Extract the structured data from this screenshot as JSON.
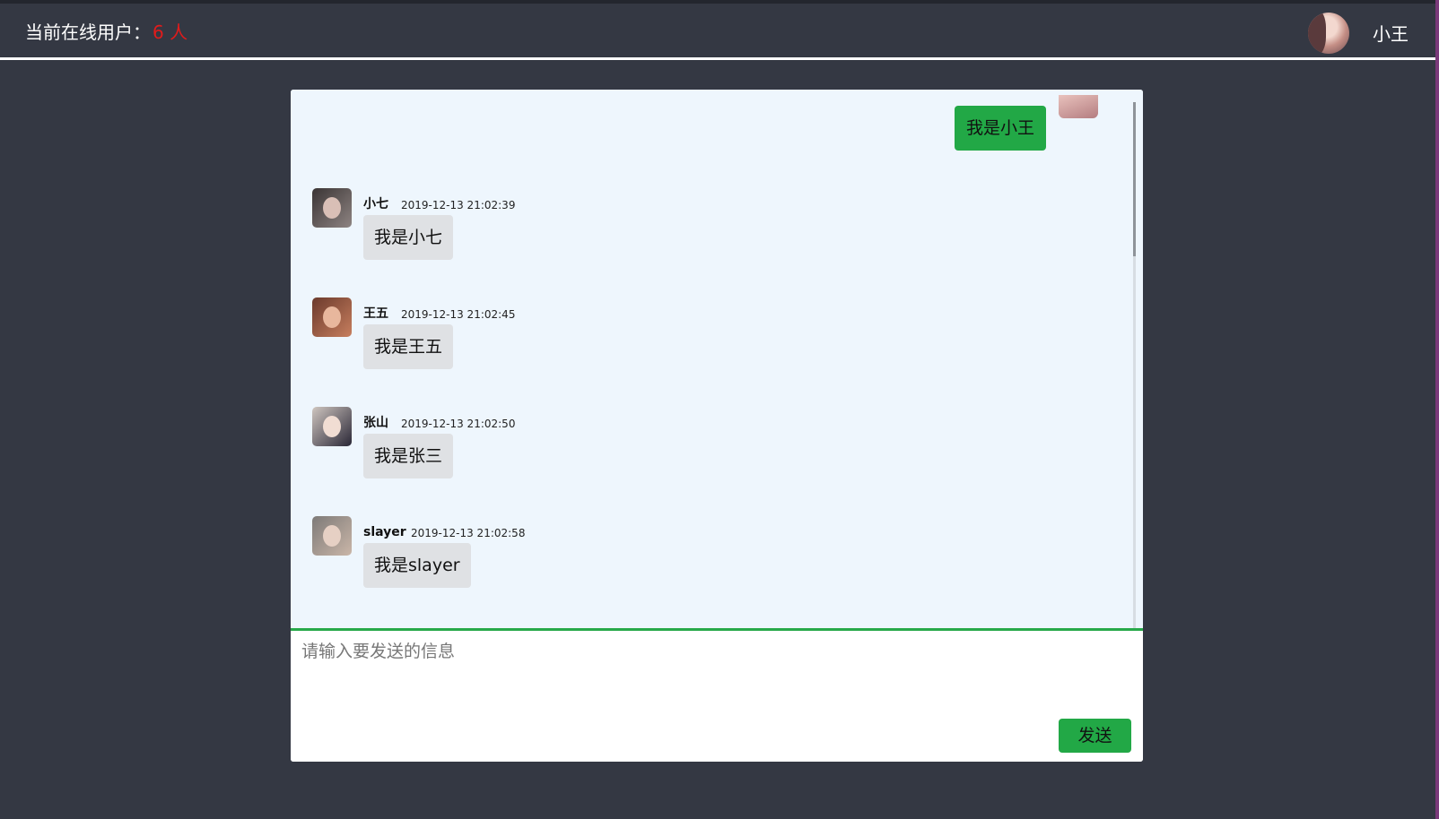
{
  "header": {
    "online_label": "当前在线用户：",
    "online_count": "6 人",
    "current_user": "小王"
  },
  "self_message": {
    "text": "我是小王"
  },
  "messages": [
    {
      "name": "小七",
      "time": "2019-12-13 21:02:39",
      "text": "我是小七"
    },
    {
      "name": "王五",
      "time": "2019-12-13 21:02:45",
      "text": "我是王五"
    },
    {
      "name": "张山",
      "time": "2019-12-13 21:02:50",
      "text": "我是张三"
    },
    {
      "name": "slayer",
      "time": "2019-12-13 21:02:58",
      "text": "我是slayer"
    }
  ],
  "composer": {
    "placeholder": "请输入要发送的信息",
    "send_label": "发送"
  },
  "colors": {
    "accent_green": "#22a846",
    "online_count_red": "#e11b1b",
    "chat_background": "#eef6fd",
    "header_background": "#343843"
  }
}
